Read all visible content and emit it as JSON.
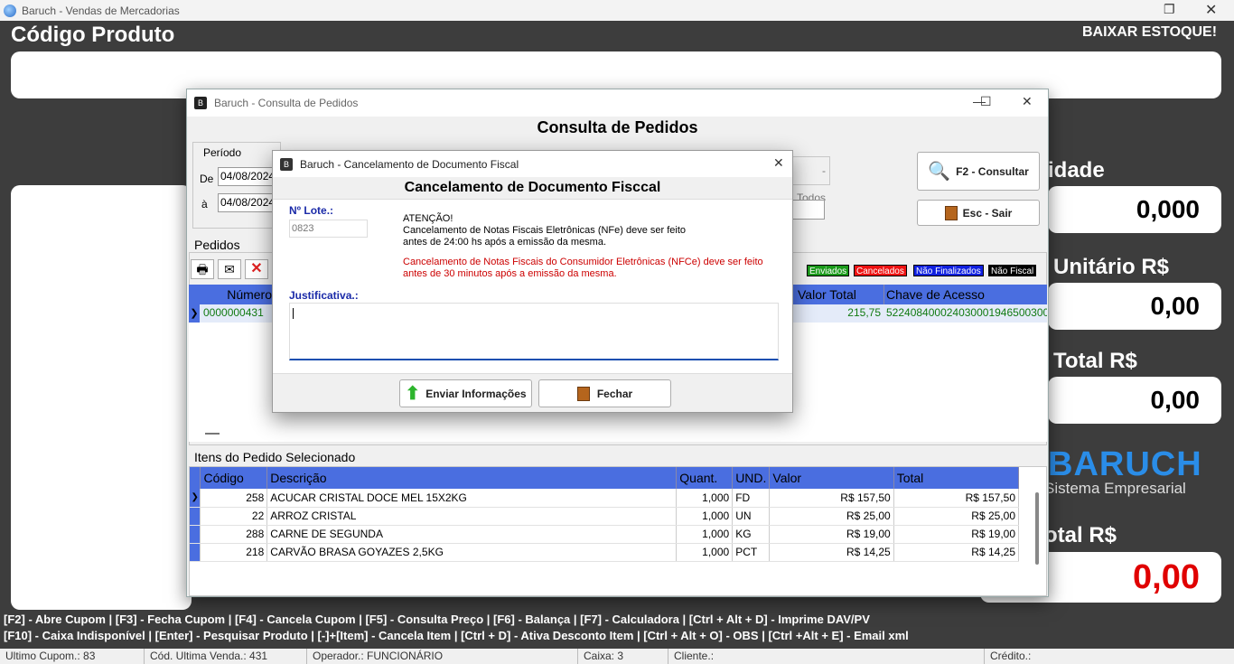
{
  "window": {
    "title": "Baruch - Vendas de Mercadorias"
  },
  "main": {
    "codigo_label": "Código Produto",
    "baixar": "BAIXAR ESTOQUE!",
    "qtd_label": "idade",
    "qtd_value": "0,000",
    "unit_label": "Unitário R$",
    "unit_value": "0,00",
    "total_label": "Total R$",
    "total_value": "0,00",
    "logo_big": "BARUCH",
    "logo_small": "Sistema Empresarial",
    "grand_label": "otal R$",
    "grand_value": "0,00"
  },
  "shortcuts": {
    "line1": "[F2] - Abre Cupom  | [F3] - Fecha Cupom  | [F4] - Cancela Cupom  | [F5] - Consulta Preço  | [F6] - Balança  | [F7] - Calculadora  | [Ctrl + Alt + D] - Imprime DAV/PV",
    "line2": "[F10] - Caixa Indisponível  | [Enter] - Pesquisar Produto  | [-]+[Item] - Cancela Item  | [Ctrl + D] - Ativa Desconto Item  | [Ctrl + Alt + O] - OBS  | [Ctrl +Alt + E] - Email xml"
  },
  "status": {
    "ultimo": "Ultimo Cupom.: 83",
    "cod": "Cód. Ultima Venda.: 431",
    "operador": "Operador.: FUNCIONÁRIO",
    "caixa": "Caixa: 3",
    "cliente": "Cliente.:",
    "credito": "Crédito.:"
  },
  "consulta": {
    "title": "Baruch - Consulta de Pedidos",
    "heading": "Consulta de Pedidos",
    "periodo": "Período",
    "de": "De",
    "a": "à",
    "date_from": "04/08/2024",
    "date_to": "04/08/2024",
    "todos": "- Todos",
    "btn_consultar": "F2 - Consultar",
    "btn_sair": "Esc - Sair",
    "pedidos": "Pedidos",
    "tags": {
      "enviados": "Enviados",
      "cancelados": "Cancelados",
      "nao_finalizados": "Não Finalizados",
      "nao_fiscal": "Não Fiscal"
    },
    "grid_cols": {
      "numero": "Número",
      "valor_total": "Valor Total",
      "chave": "Chave de Acesso"
    },
    "row": {
      "numero": "0000000431",
      "valor": "215,75",
      "chave": "522408400024030001946500300"
    },
    "itens_label": "Itens do Pedido Selecionado",
    "item_cols": [
      "Código",
      "Descrição",
      "Quant.",
      "UND.",
      "Valor",
      "Total"
    ],
    "items": [
      {
        "codigo": "258",
        "descricao": "ACUCAR CRISTAL DOCE MEL 15X2KG",
        "quant": "1,000",
        "und": "FD",
        "valor": "R$ 157,50",
        "total": "R$ 157,50"
      },
      {
        "codigo": "22",
        "descricao": "ARROZ CRISTAL",
        "quant": "1,000",
        "und": "UN",
        "valor": "R$ 25,00",
        "total": "R$ 25,00"
      },
      {
        "codigo": "288",
        "descricao": "CARNE DE SEGUNDA",
        "quant": "1,000",
        "und": "KG",
        "valor": "R$ 19,00",
        "total": "R$ 19,00"
      },
      {
        "codigo": "218",
        "descricao": "CARVÃO BRASA GOYAZES 2,5KG",
        "quant": "1,000",
        "und": "PCT",
        "valor": "R$ 14,25",
        "total": "R$ 14,25"
      }
    ]
  },
  "dialog": {
    "title": "Baruch - Cancelamento de Documento Fiscal",
    "heading": "Cancelamento de Documento Fisccal",
    "lote_label": "Nº Lote.:",
    "lote_value": "0823",
    "atencao": "ATENÇÃO!",
    "nfe1": "Cancelamento de Notas Fiscais Eletrônicas (NFe) deve ser feito",
    "nfe2": "antes de 24:00 hs após a emissão da mesma.",
    "nfce1": "Cancelamento de Notas Fiscais do Consumidor Eletrônicas (NFCe) deve ser feito",
    "nfce2": "antes de 30 minutos após a emissão da mesma.",
    "justificativa": "Justificativa.:",
    "btn_enviar": "Enviar Informações",
    "btn_fechar": "Fechar"
  }
}
